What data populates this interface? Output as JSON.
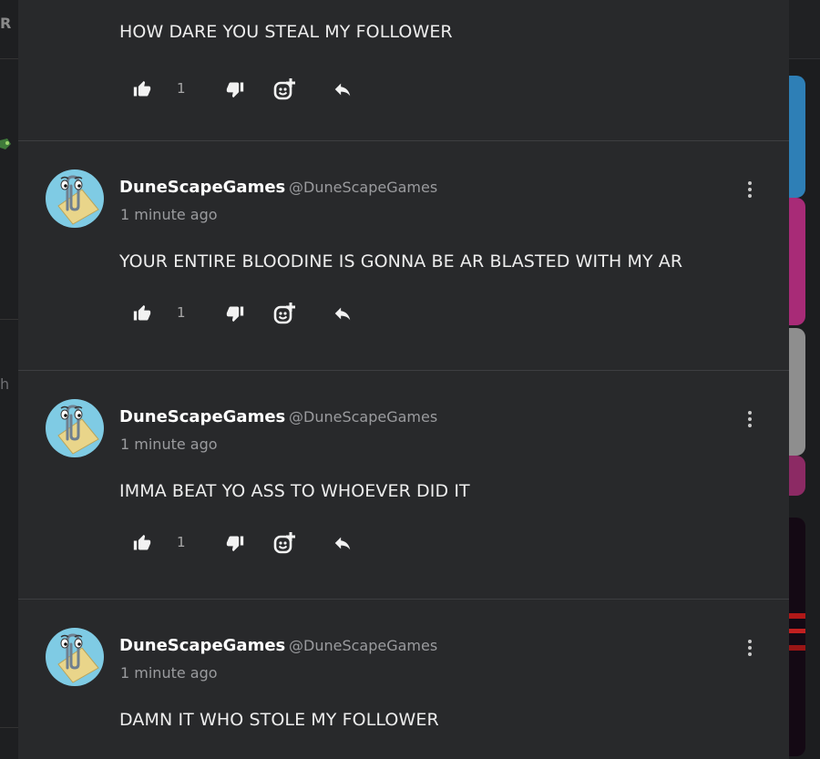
{
  "background": {
    "left_fragments": [
      "R",
      "h"
    ]
  },
  "comments": [
    {
      "author": "",
      "handle": "",
      "time": "",
      "text": "HOW DARE YOU STEAL MY FOLLOWER",
      "like_count": "1",
      "partial": true
    },
    {
      "author": "DuneScapeGames",
      "handle": "@DuneScapeGames",
      "time": "1 minute ago",
      "text": "YOUR ENTIRE BLOODINE IS GONNA BE AR BLASTED WITH MY AR",
      "like_count": "1"
    },
    {
      "author": "DuneScapeGames",
      "handle": "@DuneScapeGames",
      "time": "1 minute ago",
      "text": "IMMA BEAT YO ASS TO WHOEVER DID IT",
      "like_count": "1"
    },
    {
      "author": "DuneScapeGames",
      "handle": "@DuneScapeGames",
      "time": "1 minute ago",
      "text": "DAMN IT WHO STOLE MY FOLLOWER",
      "like_count": ""
    }
  ],
  "icons": {
    "like": "thumbs-up-icon",
    "dislike": "thumbs-down-icon",
    "react": "add-reaction-icon",
    "reply": "reply-icon",
    "more": "more-vertical-icon"
  },
  "colors": {
    "panel_bg": "#28292b",
    "page_bg": "#1b1c1e",
    "avatar_bg": "#7fcbe4",
    "text_primary": "#ffffff",
    "text_secondary": "#9a9b9e"
  }
}
